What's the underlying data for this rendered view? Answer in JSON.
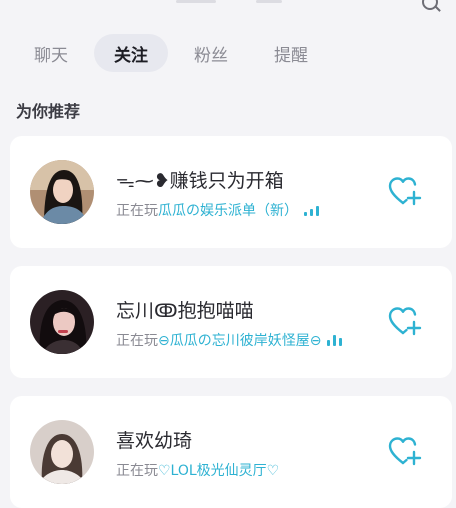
{
  "tabs": [
    {
      "label": "聊天",
      "active": false
    },
    {
      "label": "关注",
      "active": true
    },
    {
      "label": "粉丝",
      "active": false
    },
    {
      "label": "提醒",
      "active": false
    }
  ],
  "section_title": "为你推荐",
  "recommendations": [
    {
      "name": "ᯓ⁓❥赚钱只为开箱",
      "status_prefix": "正在玩",
      "game": "瓜瓜の娱乐派单（新）",
      "follow_icon": "heart-plus-icon"
    },
    {
      "name": "忘川ↂ抱抱喵喵",
      "status_prefix": "正在玩",
      "game": "⊖瓜瓜の忘川彼岸妖怪屋⊖",
      "follow_icon": "heart-plus-icon"
    },
    {
      "name": "喜欢幼琦",
      "status_prefix": "正在玩",
      "game": "♡LOL极光仙灵厅♡",
      "follow_icon": "heart-plus-icon"
    }
  ],
  "colors": {
    "accent": "#2eb2d2",
    "background": "#f4f4f7",
    "card": "#ffffff",
    "active_tab": "#e7e8ef"
  }
}
